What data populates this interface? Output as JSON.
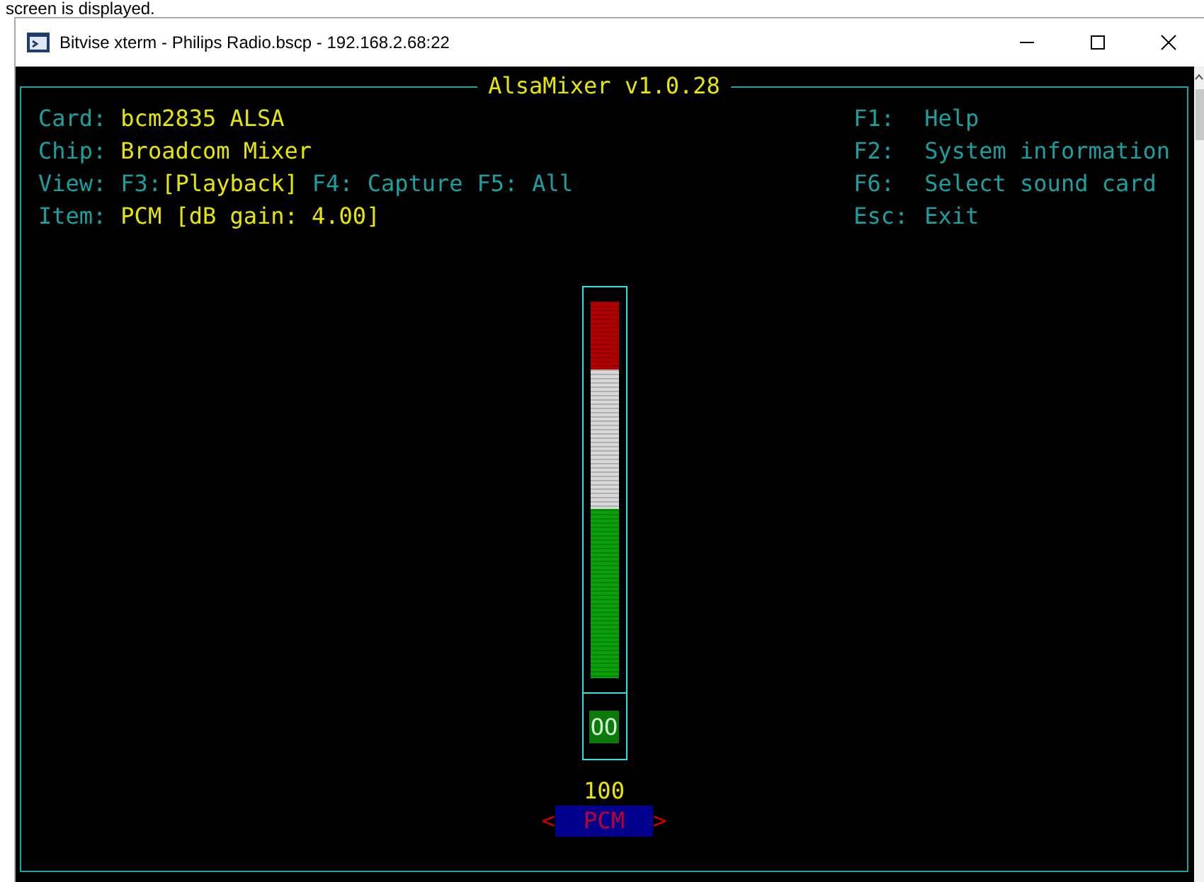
{
  "caption": "screen is displayed.",
  "window": {
    "title": "Bitvise xterm - Philips Radio.bscp - 192.168.2.68:22",
    "controls": [
      {
        "kind": "minimize"
      },
      {
        "kind": "maximize"
      },
      {
        "kind": "close"
      }
    ]
  },
  "mixer": {
    "title": "AlsaMixer v1.0.28",
    "info": [
      {
        "label": "Card:",
        "value": "bcm2835 ALSA"
      },
      {
        "label": "Chip:",
        "value": "Broadcom Mixer"
      }
    ],
    "view_label": "View:",
    "view_modes": [
      {
        "key": "F3:",
        "label": "[Playback]",
        "selected": true
      },
      {
        "key": "F4:",
        "label": "Capture",
        "selected": false
      },
      {
        "key": "F5:",
        "label": "All",
        "selected": false
      }
    ],
    "item": {
      "label": "Item:",
      "value": "PCM [dB gain: 4.00]"
    },
    "keys": [
      {
        "key": "F1:",
        "action": "Help"
      },
      {
        "key": "F2:",
        "action": "System information"
      },
      {
        "key": "F6:",
        "action": "Select sound card"
      },
      {
        "key": "Esc:",
        "action": "Exit"
      }
    ],
    "controls": [
      {
        "name": "PCM",
        "value": "100",
        "level": 1,
        "muted": false,
        "mute_text": "OO",
        "selected": true,
        "left_arrow": "<",
        "right_arrow": ">"
      }
    ]
  }
}
